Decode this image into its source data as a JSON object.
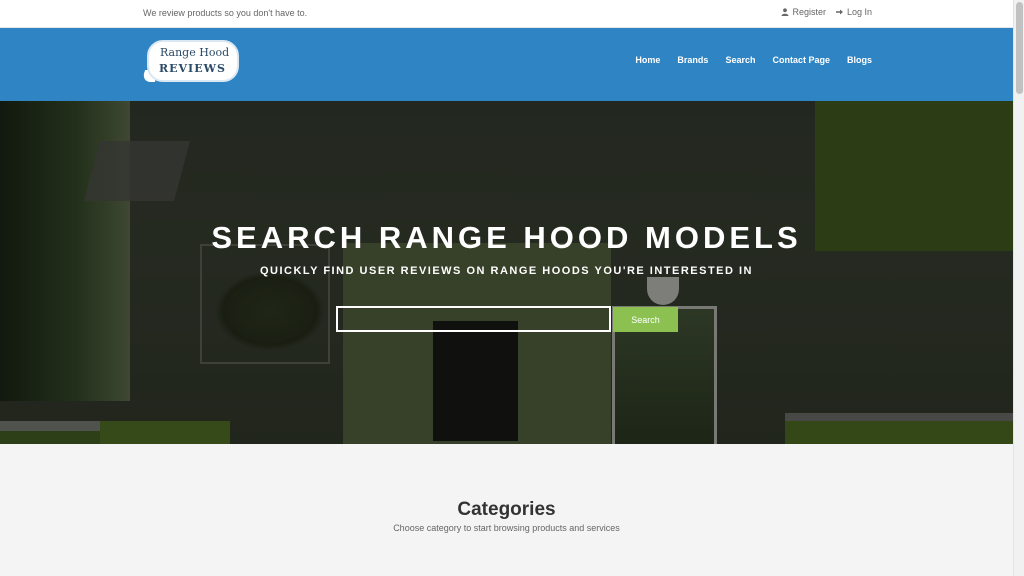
{
  "topbar": {
    "tagline": "We review products so you don't have to.",
    "register_label": "Register",
    "login_label": "Log In"
  },
  "logo": {
    "line1": "Range Hood",
    "line2": "REVIEWS"
  },
  "nav": {
    "items": [
      {
        "label": "Home"
      },
      {
        "label": "Brands"
      },
      {
        "label": "Search"
      },
      {
        "label": "Contact Page"
      },
      {
        "label": "Blogs"
      }
    ]
  },
  "hero": {
    "title": "SEARCH RANGE HOOD MODELS",
    "subtitle": "QUICKLY FIND USER REVIEWS ON RANGE HOODS YOU'RE INTERESTED IN",
    "search_value": "",
    "search_button": "Search"
  },
  "categories": {
    "title": "Categories",
    "subtitle": "Choose category to start browsing products and services"
  },
  "colors": {
    "navbar": "#2f84c4",
    "search_button": "#8cc152",
    "page_background": "#f4f4f4"
  }
}
